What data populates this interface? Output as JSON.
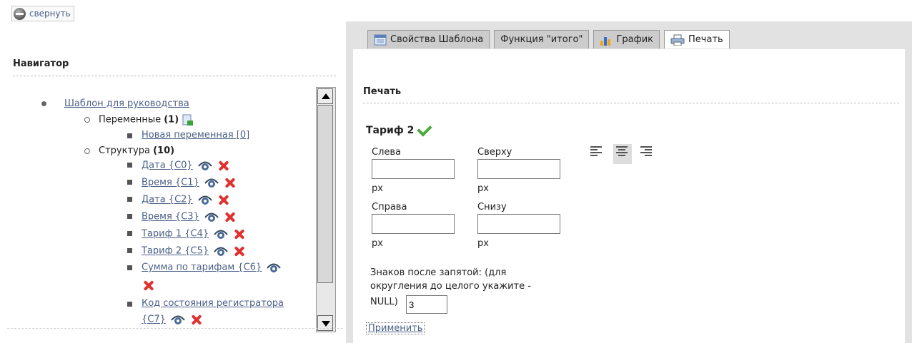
{
  "collapse": {
    "label": "свернуть",
    "icon": "collapse-icon"
  },
  "navigator": {
    "title": "Навигатор",
    "root": "Шаблон для руководства",
    "variables": {
      "label": "Переменные",
      "count": "(1)"
    },
    "new_variable": "Новая переменная [0]",
    "structure": {
      "label": "Структура",
      "count": "(10)"
    },
    "items": [
      "Дата {C0}",
      "Время {C1}",
      "Дата {C2}",
      "Время {C3}",
      "Тариф 1 {C4}",
      "Тариф 2 {C5}",
      "Сумма по тарифам {C6}",
      "Код состояния регистратора",
      "{C7}"
    ]
  },
  "tabs": [
    {
      "label": "Свойства Шаблона",
      "icon": "template-properties-icon"
    },
    {
      "label": "Функция \"итого\"",
      "icon": ""
    },
    {
      "label": "График",
      "icon": "chart-icon"
    },
    {
      "label": "Печать",
      "icon": "printer-icon"
    }
  ],
  "print": {
    "section_title": "Печать",
    "tariff_title": "Тариф 2",
    "left_label": "Слева",
    "top_label": "Сверху",
    "right_label": "Справа",
    "bottom_label": "Снизу",
    "unit": "px",
    "decimals_label_1": "Знаков после запятой: (для",
    "decimals_label_2": "округления до целого укажите -",
    "decimals_label_3": "NULL)",
    "decimals_value": "3",
    "apply": "Применить"
  }
}
